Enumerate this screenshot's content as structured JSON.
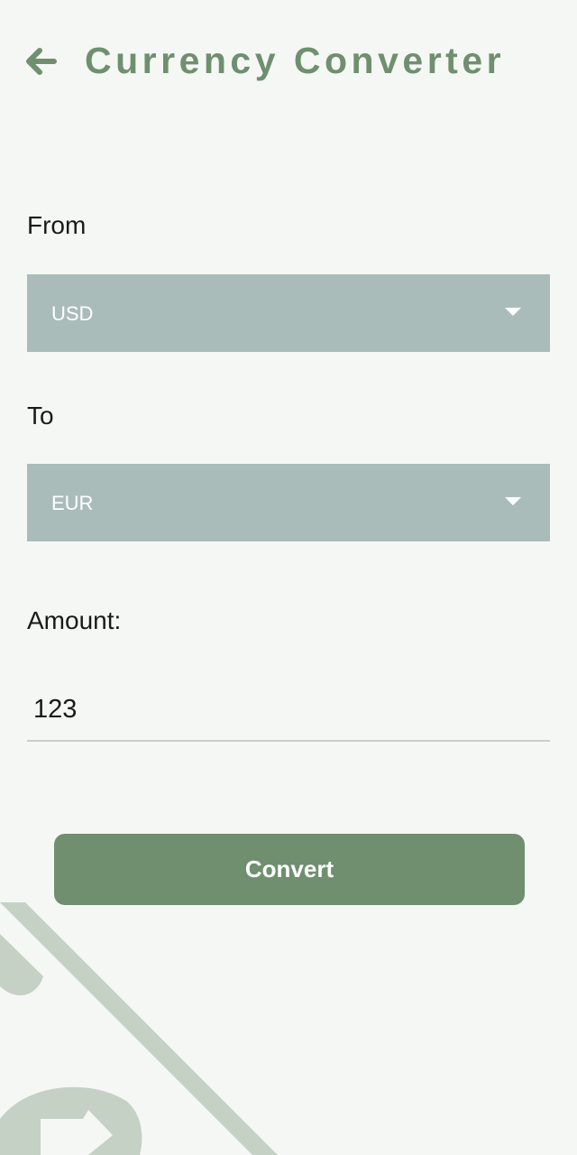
{
  "header": {
    "title": "Currency Converter",
    "back_icon": "arrow-left-icon"
  },
  "form": {
    "from_label": "From",
    "from_value": "USD",
    "to_label": "To",
    "to_value": "EUR",
    "amount_label": "Amount:",
    "amount_value": "123",
    "convert_label": "Convert"
  },
  "colors": {
    "background": "#f5f7f5",
    "accent": "#6f8f6f",
    "dropdown": "#a9bcba",
    "decoration": "#c4d1c4"
  }
}
